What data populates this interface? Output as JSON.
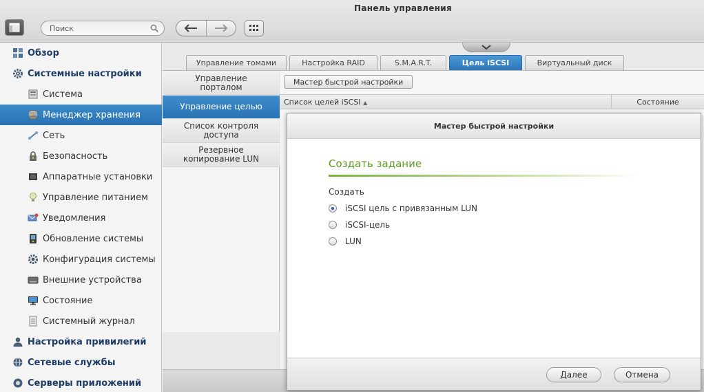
{
  "window": {
    "title": "Панель управления"
  },
  "toolbar": {
    "search_placeholder": "Поиск"
  },
  "sidebar": {
    "items": [
      {
        "label": "Обзор",
        "level": 0,
        "icon": "overview-icon"
      },
      {
        "label": "Системные настройки",
        "level": 0,
        "icon": "gear-icon"
      },
      {
        "label": "Система",
        "level": 1,
        "icon": "system-icon"
      },
      {
        "label": "Менеджер хранения",
        "level": 1,
        "icon": "storage-icon",
        "active": true
      },
      {
        "label": "Сеть",
        "level": 1,
        "icon": "network-icon"
      },
      {
        "label": "Безопасность",
        "level": 1,
        "icon": "lock-icon"
      },
      {
        "label": "Аппаратные установки",
        "level": 1,
        "icon": "hardware-icon"
      },
      {
        "label": "Управление питанием",
        "level": 1,
        "icon": "power-icon"
      },
      {
        "label": "Уведомления",
        "level": 1,
        "icon": "notification-icon"
      },
      {
        "label": "Обновление системы",
        "level": 1,
        "icon": "update-icon"
      },
      {
        "label": "Конфигурация системы",
        "level": 1,
        "icon": "config-icon"
      },
      {
        "label": "Внешние устройства",
        "level": 1,
        "icon": "external-device-icon"
      },
      {
        "label": "Состояние",
        "level": 1,
        "icon": "monitor-icon"
      },
      {
        "label": "Системный журнал",
        "level": 1,
        "icon": "log-icon"
      },
      {
        "label": "Настройка привилегий",
        "level": 0,
        "icon": "user-icon"
      },
      {
        "label": "Сетевые службы",
        "level": 0,
        "icon": "globe-icon"
      },
      {
        "label": "Серверы приложений",
        "level": 0,
        "icon": "app-server-icon"
      }
    ]
  },
  "tabs": [
    {
      "label": "Управление томами"
    },
    {
      "label": "Настройка RAID"
    },
    {
      "label": "S.M.A.R.T."
    },
    {
      "label": "Цель iSCSI",
      "active": true
    },
    {
      "label": "Виртуальный диск"
    }
  ],
  "subnav": [
    {
      "line1": "Управление",
      "line2": "порталом"
    },
    {
      "line1": "Управление целью",
      "line2": "",
      "active": true
    },
    {
      "line1": "Список контроля",
      "line2": "доступа"
    },
    {
      "line1": "Резервное",
      "line2": "копирование LUN"
    }
  ],
  "content": {
    "wizard_button": "Мастер быстрой настройки",
    "grid": {
      "col_targets": "Список целей iSCSI",
      "col_status": "Состояние"
    }
  },
  "modal": {
    "title": "Мастер быстрой настройки",
    "section_title": "Создать задание",
    "create_label": "Создать",
    "options": [
      {
        "label": "iSCSI цель с привязанным LUN",
        "checked": true
      },
      {
        "label": "iSCSI-цель",
        "checked": false
      },
      {
        "label": "LUN",
        "checked": false
      }
    ],
    "next_button": "Далее",
    "cancel_button": "Отмена"
  },
  "colors": {
    "accent_blue": "#2a73b4",
    "section_green": "#5b9a1e",
    "sidebar_heading": "#1d3d66"
  }
}
